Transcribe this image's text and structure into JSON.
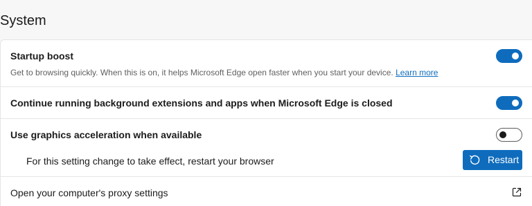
{
  "section": {
    "title": "System"
  },
  "settings": {
    "startup_boost": {
      "label": "Startup boost",
      "description": "Get to browsing quickly. When this is on, it helps Microsoft Edge open faster when you start your device.",
      "link": "Learn more",
      "enabled": true
    },
    "background_apps": {
      "label": "Continue running background extensions and apps when Microsoft Edge is closed",
      "enabled": true
    },
    "graphics_acceleration": {
      "label": "Use graphics acceleration when available",
      "enabled": false,
      "restart_message": "For this setting change to take effect, restart your browser",
      "restart_button": "Restart",
      "restart_icon": "restart-icon"
    },
    "proxy": {
      "label": "Open your computer's proxy settings",
      "icon": "external-link-icon"
    }
  },
  "colors": {
    "accent": "#0f6cbd",
    "page_background": "#f7f7f7",
    "card_background": "#ffffff",
    "divider": "#e6e6e6"
  }
}
